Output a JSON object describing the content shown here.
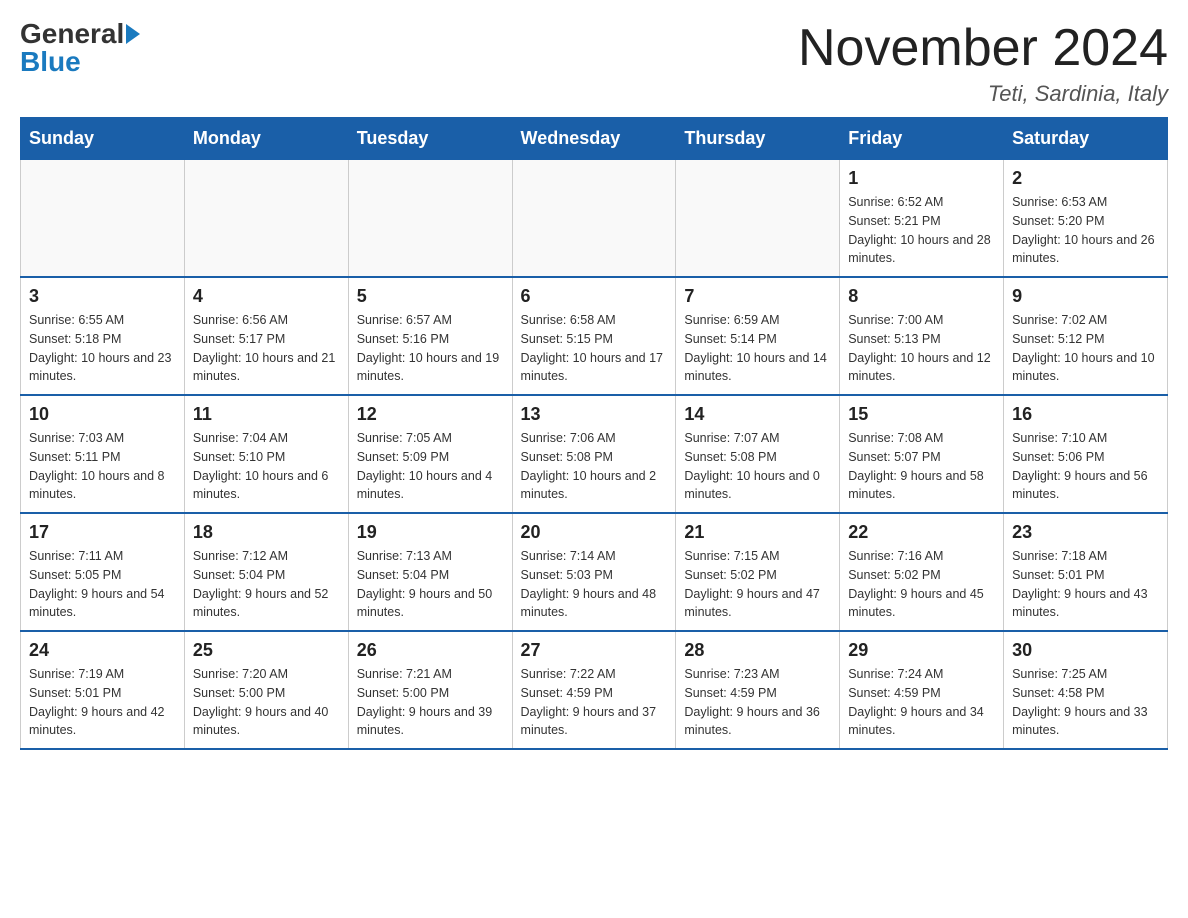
{
  "header": {
    "logo": {
      "general": "General",
      "blue": "Blue"
    },
    "month_title": "November 2024",
    "location": "Teti, Sardinia, Italy"
  },
  "weekdays": [
    "Sunday",
    "Monday",
    "Tuesday",
    "Wednesday",
    "Thursday",
    "Friday",
    "Saturday"
  ],
  "weeks": [
    [
      {
        "day": "",
        "info": ""
      },
      {
        "day": "",
        "info": ""
      },
      {
        "day": "",
        "info": ""
      },
      {
        "day": "",
        "info": ""
      },
      {
        "day": "",
        "info": ""
      },
      {
        "day": "1",
        "info": "Sunrise: 6:52 AM\nSunset: 5:21 PM\nDaylight: 10 hours and 28 minutes."
      },
      {
        "day": "2",
        "info": "Sunrise: 6:53 AM\nSunset: 5:20 PM\nDaylight: 10 hours and 26 minutes."
      }
    ],
    [
      {
        "day": "3",
        "info": "Sunrise: 6:55 AM\nSunset: 5:18 PM\nDaylight: 10 hours and 23 minutes."
      },
      {
        "day": "4",
        "info": "Sunrise: 6:56 AM\nSunset: 5:17 PM\nDaylight: 10 hours and 21 minutes."
      },
      {
        "day": "5",
        "info": "Sunrise: 6:57 AM\nSunset: 5:16 PM\nDaylight: 10 hours and 19 minutes."
      },
      {
        "day": "6",
        "info": "Sunrise: 6:58 AM\nSunset: 5:15 PM\nDaylight: 10 hours and 17 minutes."
      },
      {
        "day": "7",
        "info": "Sunrise: 6:59 AM\nSunset: 5:14 PM\nDaylight: 10 hours and 14 minutes."
      },
      {
        "day": "8",
        "info": "Sunrise: 7:00 AM\nSunset: 5:13 PM\nDaylight: 10 hours and 12 minutes."
      },
      {
        "day": "9",
        "info": "Sunrise: 7:02 AM\nSunset: 5:12 PM\nDaylight: 10 hours and 10 minutes."
      }
    ],
    [
      {
        "day": "10",
        "info": "Sunrise: 7:03 AM\nSunset: 5:11 PM\nDaylight: 10 hours and 8 minutes."
      },
      {
        "day": "11",
        "info": "Sunrise: 7:04 AM\nSunset: 5:10 PM\nDaylight: 10 hours and 6 minutes."
      },
      {
        "day": "12",
        "info": "Sunrise: 7:05 AM\nSunset: 5:09 PM\nDaylight: 10 hours and 4 minutes."
      },
      {
        "day": "13",
        "info": "Sunrise: 7:06 AM\nSunset: 5:08 PM\nDaylight: 10 hours and 2 minutes."
      },
      {
        "day": "14",
        "info": "Sunrise: 7:07 AM\nSunset: 5:08 PM\nDaylight: 10 hours and 0 minutes."
      },
      {
        "day": "15",
        "info": "Sunrise: 7:08 AM\nSunset: 5:07 PM\nDaylight: 9 hours and 58 minutes."
      },
      {
        "day": "16",
        "info": "Sunrise: 7:10 AM\nSunset: 5:06 PM\nDaylight: 9 hours and 56 minutes."
      }
    ],
    [
      {
        "day": "17",
        "info": "Sunrise: 7:11 AM\nSunset: 5:05 PM\nDaylight: 9 hours and 54 minutes."
      },
      {
        "day": "18",
        "info": "Sunrise: 7:12 AM\nSunset: 5:04 PM\nDaylight: 9 hours and 52 minutes."
      },
      {
        "day": "19",
        "info": "Sunrise: 7:13 AM\nSunset: 5:04 PM\nDaylight: 9 hours and 50 minutes."
      },
      {
        "day": "20",
        "info": "Sunrise: 7:14 AM\nSunset: 5:03 PM\nDaylight: 9 hours and 48 minutes."
      },
      {
        "day": "21",
        "info": "Sunrise: 7:15 AM\nSunset: 5:02 PM\nDaylight: 9 hours and 47 minutes."
      },
      {
        "day": "22",
        "info": "Sunrise: 7:16 AM\nSunset: 5:02 PM\nDaylight: 9 hours and 45 minutes."
      },
      {
        "day": "23",
        "info": "Sunrise: 7:18 AM\nSunset: 5:01 PM\nDaylight: 9 hours and 43 minutes."
      }
    ],
    [
      {
        "day": "24",
        "info": "Sunrise: 7:19 AM\nSunset: 5:01 PM\nDaylight: 9 hours and 42 minutes."
      },
      {
        "day": "25",
        "info": "Sunrise: 7:20 AM\nSunset: 5:00 PM\nDaylight: 9 hours and 40 minutes."
      },
      {
        "day": "26",
        "info": "Sunrise: 7:21 AM\nSunset: 5:00 PM\nDaylight: 9 hours and 39 minutes."
      },
      {
        "day": "27",
        "info": "Sunrise: 7:22 AM\nSunset: 4:59 PM\nDaylight: 9 hours and 37 minutes."
      },
      {
        "day": "28",
        "info": "Sunrise: 7:23 AM\nSunset: 4:59 PM\nDaylight: 9 hours and 36 minutes."
      },
      {
        "day": "29",
        "info": "Sunrise: 7:24 AM\nSunset: 4:59 PM\nDaylight: 9 hours and 34 minutes."
      },
      {
        "day": "30",
        "info": "Sunrise: 7:25 AM\nSunset: 4:58 PM\nDaylight: 9 hours and 33 minutes."
      }
    ]
  ]
}
